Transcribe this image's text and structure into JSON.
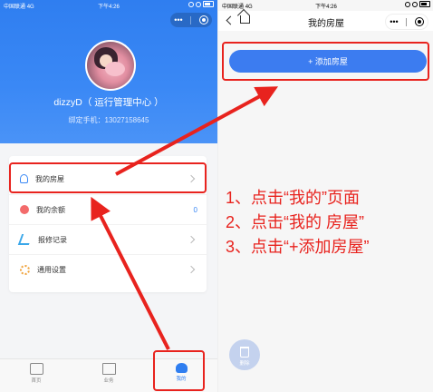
{
  "left": {
    "status": {
      "carrier": "中国联通",
      "network": "4G",
      "time": "下午4:26"
    },
    "capsule": {
      "more": "•••"
    },
    "user": {
      "name": "dizzyD（ 运行管理中心 ）",
      "phone": "绑定手机：13027158645"
    },
    "menu": [
      {
        "label": "我的房屋",
        "icon": "user-icon"
      },
      {
        "label": "我的余额",
        "icon": "money-bag-icon",
        "count": "0"
      },
      {
        "label": "报修记录",
        "icon": "repair-icon"
      },
      {
        "label": "通用设置",
        "icon": "gear-icon"
      }
    ],
    "tabs": [
      {
        "label": "首页",
        "icon": "home-icon"
      },
      {
        "label": "业务",
        "icon": "document-icon"
      },
      {
        "label": "我的",
        "icon": "profile-icon"
      }
    ]
  },
  "right": {
    "status": {
      "carrier": "中国联通",
      "network": "4G",
      "time": "下午4:26"
    },
    "title": "我的房屋",
    "capsule": {
      "more": "•••"
    },
    "add_button": "+ 添加房屋",
    "delete_label": "删除"
  },
  "instructions": [
    "1、点击“我的”页面",
    "2、点击“我的 房屋”",
    "3、点击“+添加房屋”"
  ],
  "colors": {
    "primary": "#3c7cf0",
    "annotation": "#e8231e"
  }
}
